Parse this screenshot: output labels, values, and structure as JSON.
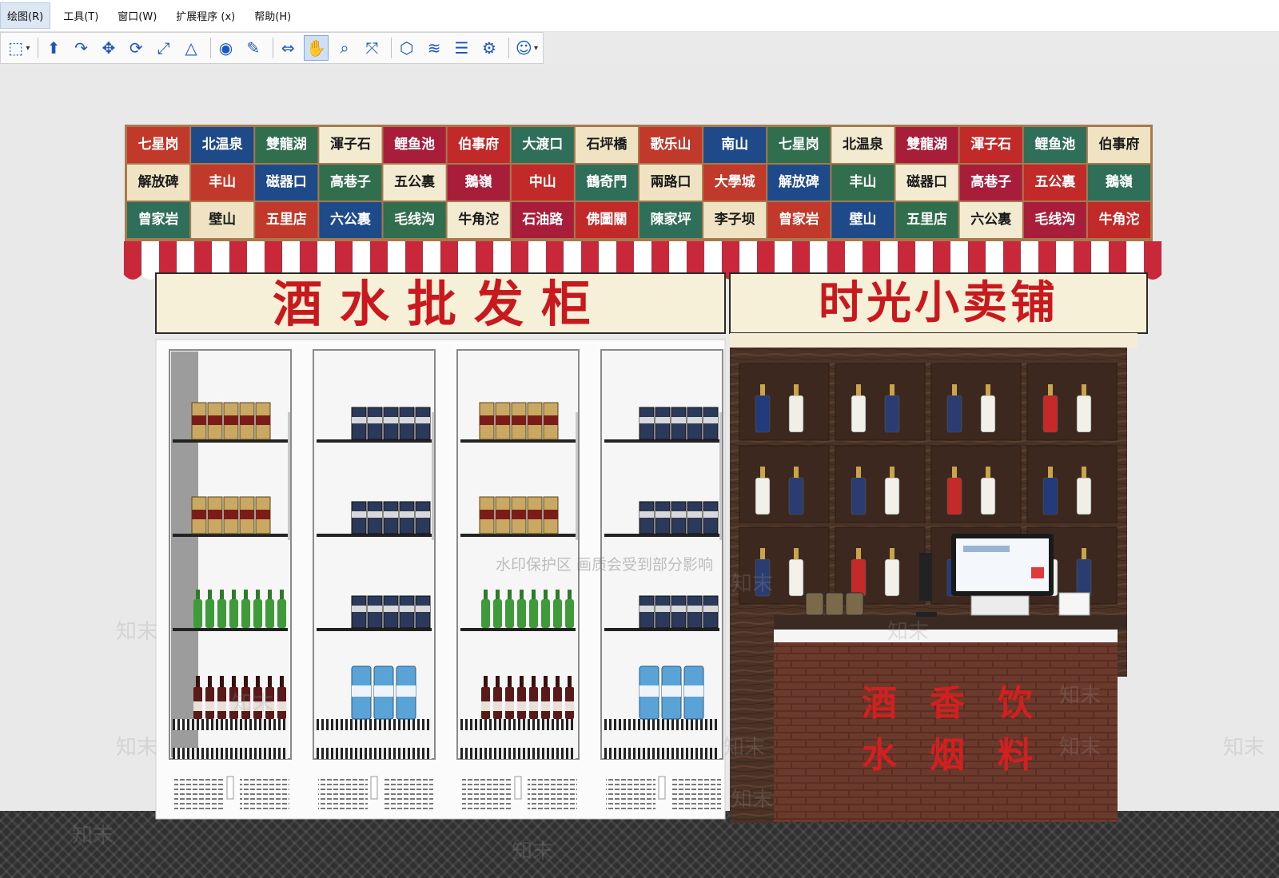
{
  "menu": [
    {
      "label": "绘图(R)",
      "active": true
    },
    {
      "label": "工具(T)",
      "active": false
    },
    {
      "label": "窗口(W)",
      "active": false
    },
    {
      "label": "扩展程序 (x)",
      "active": false
    },
    {
      "label": "帮助(H)",
      "active": false
    }
  ],
  "toolbar": [
    {
      "icon": "select-icon",
      "glyph": "⬚",
      "dropdown": true
    },
    {
      "sep": true
    },
    {
      "icon": "push-pull-icon",
      "glyph": "⬆"
    },
    {
      "icon": "follow-me-icon",
      "glyph": "↷"
    },
    {
      "icon": "move-icon",
      "glyph": "✥"
    },
    {
      "icon": "rotate-icon",
      "glyph": "⟳"
    },
    {
      "icon": "scale-icon",
      "glyph": "⤢"
    },
    {
      "icon": "offset-icon",
      "glyph": "△"
    },
    {
      "sep": true
    },
    {
      "icon": "tape-measure-icon",
      "glyph": "◉"
    },
    {
      "icon": "paint-bucket-icon",
      "glyph": "✎"
    },
    {
      "sep": true
    },
    {
      "icon": "orbit-icon",
      "glyph": "⇔"
    },
    {
      "icon": "pan-icon",
      "glyph": "✋",
      "active": true
    },
    {
      "icon": "zoom-icon",
      "glyph": "⌕"
    },
    {
      "icon": "zoom-extents-icon",
      "glyph": "⤧"
    },
    {
      "sep": true
    },
    {
      "icon": "warehouse-icon",
      "glyph": "⬡"
    },
    {
      "icon": "extension-icon",
      "glyph": "≋"
    },
    {
      "icon": "layers-icon",
      "glyph": "☰"
    },
    {
      "icon": "styles-icon",
      "glyph": "⚙"
    },
    {
      "sep": true
    },
    {
      "icon": "account-icon",
      "glyph": "☺",
      "dropdown": true
    }
  ],
  "scene": {
    "sign_left": "酒水批发柜",
    "sign_right": "时光小卖铺",
    "counter_text": [
      "酒",
      "香",
      "饮",
      "水",
      "烟",
      "料"
    ],
    "watermark_text": "知末",
    "watermark_note": "水印保护区 画质会受到部分影响",
    "tiles": [
      [
        "七星岗",
        "北温泉",
        "雙龍湖",
        "渾子石",
        "鲤鱼池",
        "伯事府",
        "大渡口",
        "石坪橋",
        "歌乐山",
        "南山",
        "七星岗",
        "北温泉",
        "雙龍湖",
        "渾子石",
        "鲤鱼池",
        "伯事府"
      ],
      [
        "解放碑",
        "丰山",
        "磁器口",
        "高巷子",
        "五公裏",
        "鵝嶺",
        "中山",
        "鶴奇門",
        "兩路口",
        "大學城",
        "解放碑",
        "丰山",
        "磁器口",
        "高巷子",
        "五公裏",
        "鵝嶺"
      ],
      [
        "曾家岩",
        "壁山",
        "五里店",
        "六公裏",
        "毛线沟",
        "牛角沱",
        "石油路",
        "佛圖關",
        "陳家坪",
        "李子坝",
        "曾家岩",
        "壁山",
        "五里店",
        "六公裏",
        "毛线沟",
        "牛角沱"
      ]
    ]
  },
  "colors": {
    "sign_bg": "#f7f0d8",
    "sign_text": "#c8191e",
    "awning_red": "#c8283a",
    "cabinet_white": "#fbfbfb",
    "wood": "#4a3226",
    "accent": "#1b57c2"
  }
}
